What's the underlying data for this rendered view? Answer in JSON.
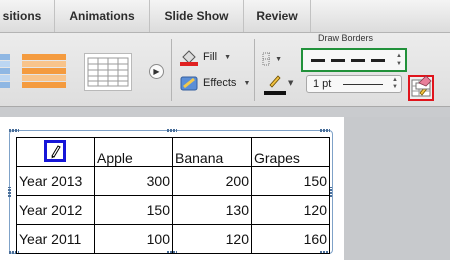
{
  "tabs": [
    {
      "label": "sitions"
    },
    {
      "label": "Animations"
    },
    {
      "label": "Slide Show"
    },
    {
      "label": "Review"
    }
  ],
  "ribbon": {
    "fill_label": "Fill",
    "effects_label": "Effects",
    "draw_borders_title": "Draw Borders",
    "line_weight": "1 pt",
    "colors": {
      "line_style_highlight": "#21913a",
      "draw_table_highlight": "#e0141c",
      "pencil_cell_highlight": "#1616d8"
    }
  },
  "table": {
    "header": [
      "",
      "Apple",
      "Banana",
      "Grapes"
    ],
    "rows": [
      {
        "label": "Year 2013",
        "values": [
          "300",
          "200",
          "150"
        ]
      },
      {
        "label": "Year 2012",
        "values": [
          "150",
          "130",
          "120"
        ]
      },
      {
        "label": "Year 2011",
        "values": [
          "100",
          "120",
          "160"
        ]
      }
    ]
  }
}
